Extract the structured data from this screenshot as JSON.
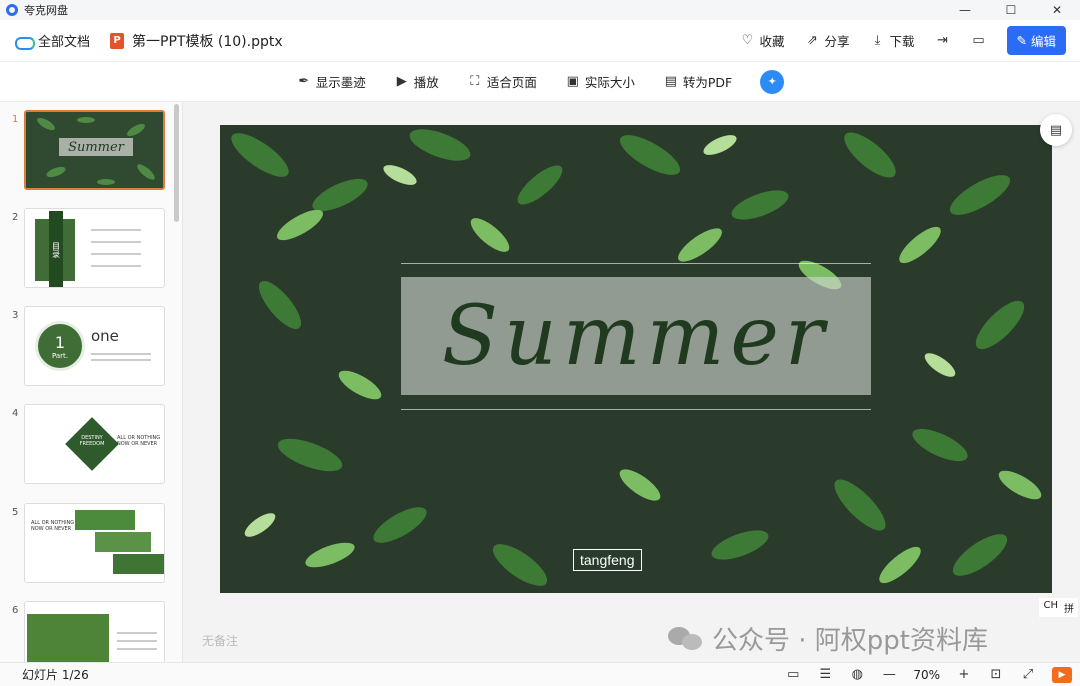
{
  "window": {
    "title": "夸克网盘",
    "minimize": "—",
    "maximize": "☐",
    "close": "✕"
  },
  "topbar": {
    "breadcrumb": "全部文档",
    "ppt_badge": "P",
    "filename": "第一PPT模板 (10).pptx",
    "actions": {
      "favorite": "收藏",
      "share": "分享",
      "download": "下载",
      "edit": "编辑"
    }
  },
  "toolbar": {
    "ink": "显示墨迹",
    "play": "播放",
    "fit": "适合页面",
    "actual": "实际大小",
    "pdf": "转为PDF"
  },
  "sidebar": {
    "thumbnails": [
      {
        "num": "1",
        "title": "Summer",
        "active": true
      },
      {
        "num": "2",
        "title": "目录"
      },
      {
        "num": "3",
        "title": "one",
        "sub": "1",
        "part": "Part."
      },
      {
        "num": "4",
        "title": "DESTINY FREEDOM",
        "sub": "ALL OR NOTHING NOW OR NEVER"
      },
      {
        "num": "5",
        "title": "ALL OR NOTHING NOW OR NEVER"
      },
      {
        "num": "6",
        "title": ""
      }
    ]
  },
  "slide": {
    "title": "Summer",
    "author": "tangfeng"
  },
  "notes": "无备注",
  "ime": {
    "lang": "CH",
    "mode": "拼"
  },
  "watermark": "公众号 · 阿权ppt资料库",
  "status": {
    "slide_counter": "幻灯片 1/26",
    "zoom": "70%"
  },
  "colors": {
    "accent": "#2b6cf6",
    "ppt": "#e5532d",
    "leaf_dark": "#2a3a2b",
    "active_border": "#e07b3a"
  }
}
